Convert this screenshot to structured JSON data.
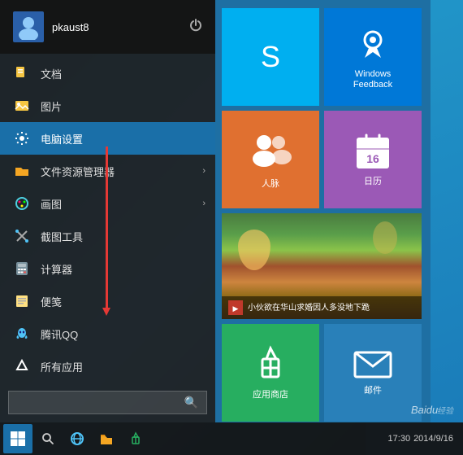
{
  "desktop": {
    "background": "#1a6fa8"
  },
  "user": {
    "name": "pkaust8",
    "avatar_alt": "user avatar"
  },
  "menu": {
    "items": [
      {
        "id": "documents",
        "label": "文档",
        "icon": "document-icon"
      },
      {
        "id": "pictures",
        "label": "图片",
        "icon": "picture-icon"
      },
      {
        "id": "pc-settings",
        "label": "电脑设置",
        "icon": "settings-icon",
        "active": true
      },
      {
        "id": "file-explorer",
        "label": "文件资源管理器",
        "icon": "folder-icon",
        "has_arrow": true
      },
      {
        "id": "paint",
        "label": "画图",
        "icon": "paint-icon",
        "has_arrow": true
      },
      {
        "id": "snipping-tool",
        "label": "截图工具",
        "icon": "snipping-icon"
      },
      {
        "id": "calculator",
        "label": "计算器",
        "icon": "calc-icon"
      },
      {
        "id": "notepad",
        "label": "便笺",
        "icon": "notepad-icon"
      },
      {
        "id": "tencent-qq",
        "label": "腾讯QQ",
        "icon": "qq-icon"
      },
      {
        "id": "all-apps",
        "label": "所有应用",
        "icon": "all-apps-icon"
      }
    ],
    "search_placeholder": ""
  },
  "tiles": {
    "skype": {
      "label": ""
    },
    "music": {
      "label": ""
    },
    "feedback": {
      "label": "Windows\nFeedback"
    },
    "people": {
      "label": "人脉"
    },
    "calendar": {
      "label": "日历"
    },
    "news": {
      "text": "小伙欲在华山求婚因人多没地下跪"
    },
    "store": {
      "label": "应用商店"
    },
    "mail": {
      "label": "邮件"
    }
  },
  "taskbar": {
    "start_label": "Start",
    "search_label": "Search",
    "ie_label": "Internet Explorer",
    "explorer_label": "File Explorer",
    "store_label": "Store",
    "tray_time": "17:30",
    "tray_date": "2014/9/16"
  }
}
